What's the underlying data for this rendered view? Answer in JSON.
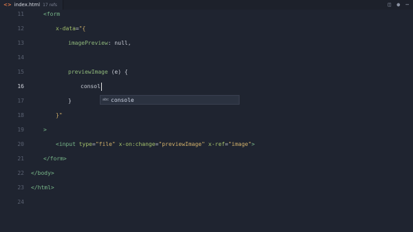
{
  "tab": {
    "icon_text": "<>",
    "filename": "index.html",
    "subtitle": "17 refs"
  },
  "lines": [
    {
      "no": "11",
      "html": "<span class=\"tag\">&lt;form</span>",
      "indent": 1
    },
    {
      "no": "12",
      "html": "<span class=\"attr\">x-data</span><span class=\"txt\">=</span><span class=\"str\">\"{</span>",
      "indent": 2
    },
    {
      "no": "13",
      "html": "<span class=\"kw\">imagePreview</span><span class=\"txt\">: null,</span>",
      "indent": 3
    },
    {
      "no": "14",
      "html": "",
      "indent": 0
    },
    {
      "no": "15",
      "html": "<span class=\"kw\">previewImage</span><span class=\"txt\"> (e) {</span>",
      "indent": 3
    },
    {
      "no": "16",
      "html": "<span class=\"txt\">consol</span><span class=\"cursor\"></span>",
      "indent": 4,
      "active": true
    },
    {
      "no": "17",
      "html": "<span class=\"txt\">}</span>",
      "indent": 3
    },
    {
      "no": "18",
      "html": "<span class=\"str\">}\"</span>",
      "indent": 2
    },
    {
      "no": "19",
      "html": "<span class=\"tag\">&gt;</span>",
      "indent": 1
    },
    {
      "no": "20",
      "html": "<span class=\"tag\">&lt;input</span> <span class=\"attr\">type</span><span class=\"txt\">=</span><span class=\"str\">\"file\"</span> <span class=\"attr\">x-on:change</span><span class=\"txt\">=</span><span class=\"str\">\"previewImage\"</span> <span class=\"attr\">x-ref</span><span class=\"txt\">=</span><span class=\"str\">\"image\"</span><span class=\"tag\">&gt;</span>",
      "indent": 2
    },
    {
      "no": "21",
      "html": "<span class=\"tag\">&lt;/form&gt;</span>",
      "indent": 1
    },
    {
      "no": "22",
      "html": "<span class=\"tag\">&lt;/body&gt;</span>",
      "indent": 0
    },
    {
      "no": "23",
      "html": "<span class=\"tag\">&lt;/html&gt;</span>",
      "indent": 0
    },
    {
      "no": "24",
      "html": "",
      "indent": 0
    }
  ],
  "suggestion": {
    "icon_text": "abc",
    "label": "console"
  }
}
